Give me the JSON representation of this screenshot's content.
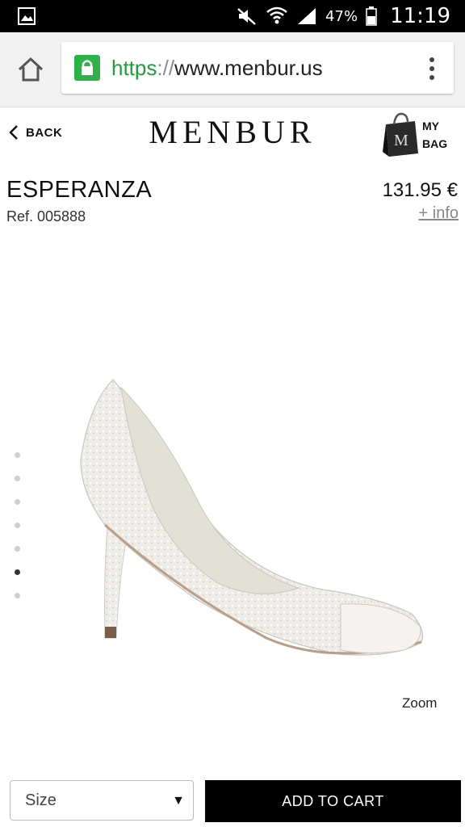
{
  "status_bar": {
    "battery": "47%",
    "time": "11:19",
    "icons": [
      "gallery-icon",
      "mute-icon",
      "wifi-icon",
      "signal-icon",
      "battery-icon"
    ]
  },
  "browser": {
    "url_scheme": "https",
    "url_separator": "://",
    "url_host": "www.menbur.us",
    "icons": [
      "home-icon",
      "lock-icon",
      "overflow-menu-icon"
    ]
  },
  "header": {
    "back_label": "BACK",
    "logo": "MENBUR",
    "bag_label_line1": "MY",
    "bag_label_line2": "BAG"
  },
  "product": {
    "name": "ESPERANZA",
    "ref": "Ref. 005888",
    "price": "131.95 €",
    "more_info": "+ info",
    "gallery_count": 7,
    "gallery_active_index": 5,
    "zoom_label": "Zoom"
  },
  "purchase": {
    "size_label": "Size",
    "add_to_cart": "ADD TO CART"
  },
  "colors": {
    "status_bar": "#000000",
    "browser_bar": "#f1f1f1",
    "secure_green": "#2db24a",
    "button_black": "#000000"
  }
}
